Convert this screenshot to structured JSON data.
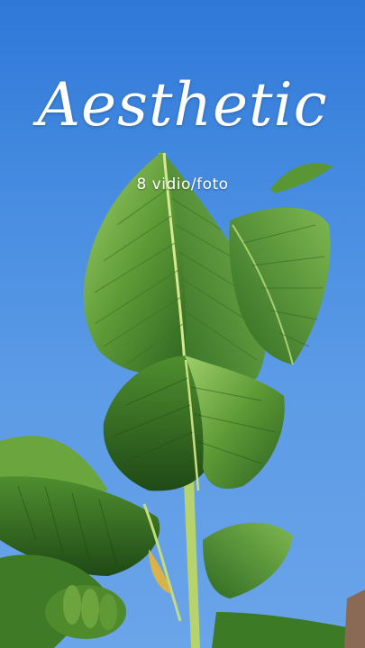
{
  "overlay": {
    "title": "Aesthetic",
    "subtitle": "8 vidio/foto"
  },
  "colors": {
    "sky": "#4a8fe2",
    "leaf_dark": "#2f6a1f",
    "leaf_mid": "#4f8f2e",
    "leaf_light": "#8ec15a"
  }
}
